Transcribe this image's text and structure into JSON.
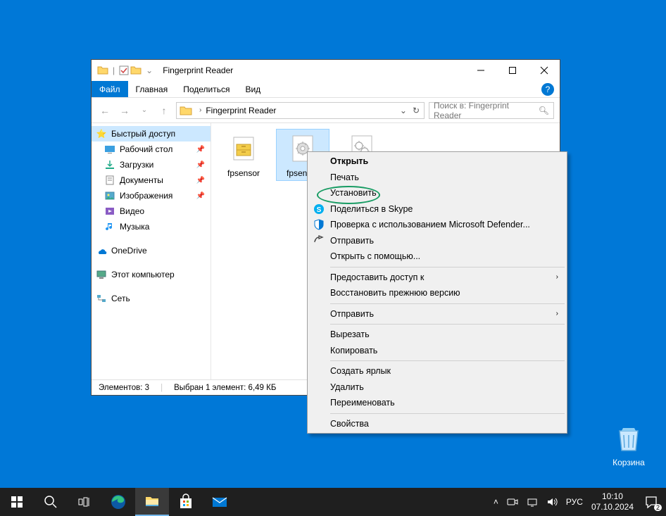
{
  "window": {
    "title": "Fingerprint Reader",
    "tabs": {
      "file": "Файл",
      "home": "Главная",
      "share": "Поделиться",
      "view": "Вид"
    },
    "breadcrumb": "Fingerprint Reader",
    "search_placeholder": "Поиск в: Fingerprint Reader"
  },
  "sidebar": {
    "quick": "Быстрый доступ",
    "desktop": "Рабочий стол",
    "downloads": "Загрузки",
    "documents": "Документы",
    "pictures": "Изображения",
    "videos": "Видео",
    "music": "Музыка",
    "onedrive": "OneDrive",
    "thispc": "Этот компьютер",
    "network": "Сеть"
  },
  "files": {
    "f1": "fpsensor",
    "f2": "fpsensor",
    "f3": ""
  },
  "status": {
    "count": "Элементов: 3",
    "selection": "Выбран 1 элемент: 6,49 КБ"
  },
  "context": {
    "open": "Открыть",
    "print": "Печать",
    "install": "Установить",
    "skype": "Поделиться в Skype",
    "defender": "Проверка с использованием Microsoft Defender...",
    "share": "Отправить",
    "openwith": "Открыть с помощью...",
    "grantaccess": "Предоставить доступ к",
    "restore": "Восстановить прежнюю версию",
    "sendto": "Отправить",
    "cut": "Вырезать",
    "copy": "Копировать",
    "shortcut": "Создать ярлык",
    "delete": "Удалить",
    "rename": "Переименовать",
    "properties": "Свойства"
  },
  "desktop": {
    "recyclebin": "Корзина"
  },
  "tray": {
    "lang": "РУС",
    "time": "10:10",
    "date": "07.10.2024",
    "notif_count": "2"
  }
}
